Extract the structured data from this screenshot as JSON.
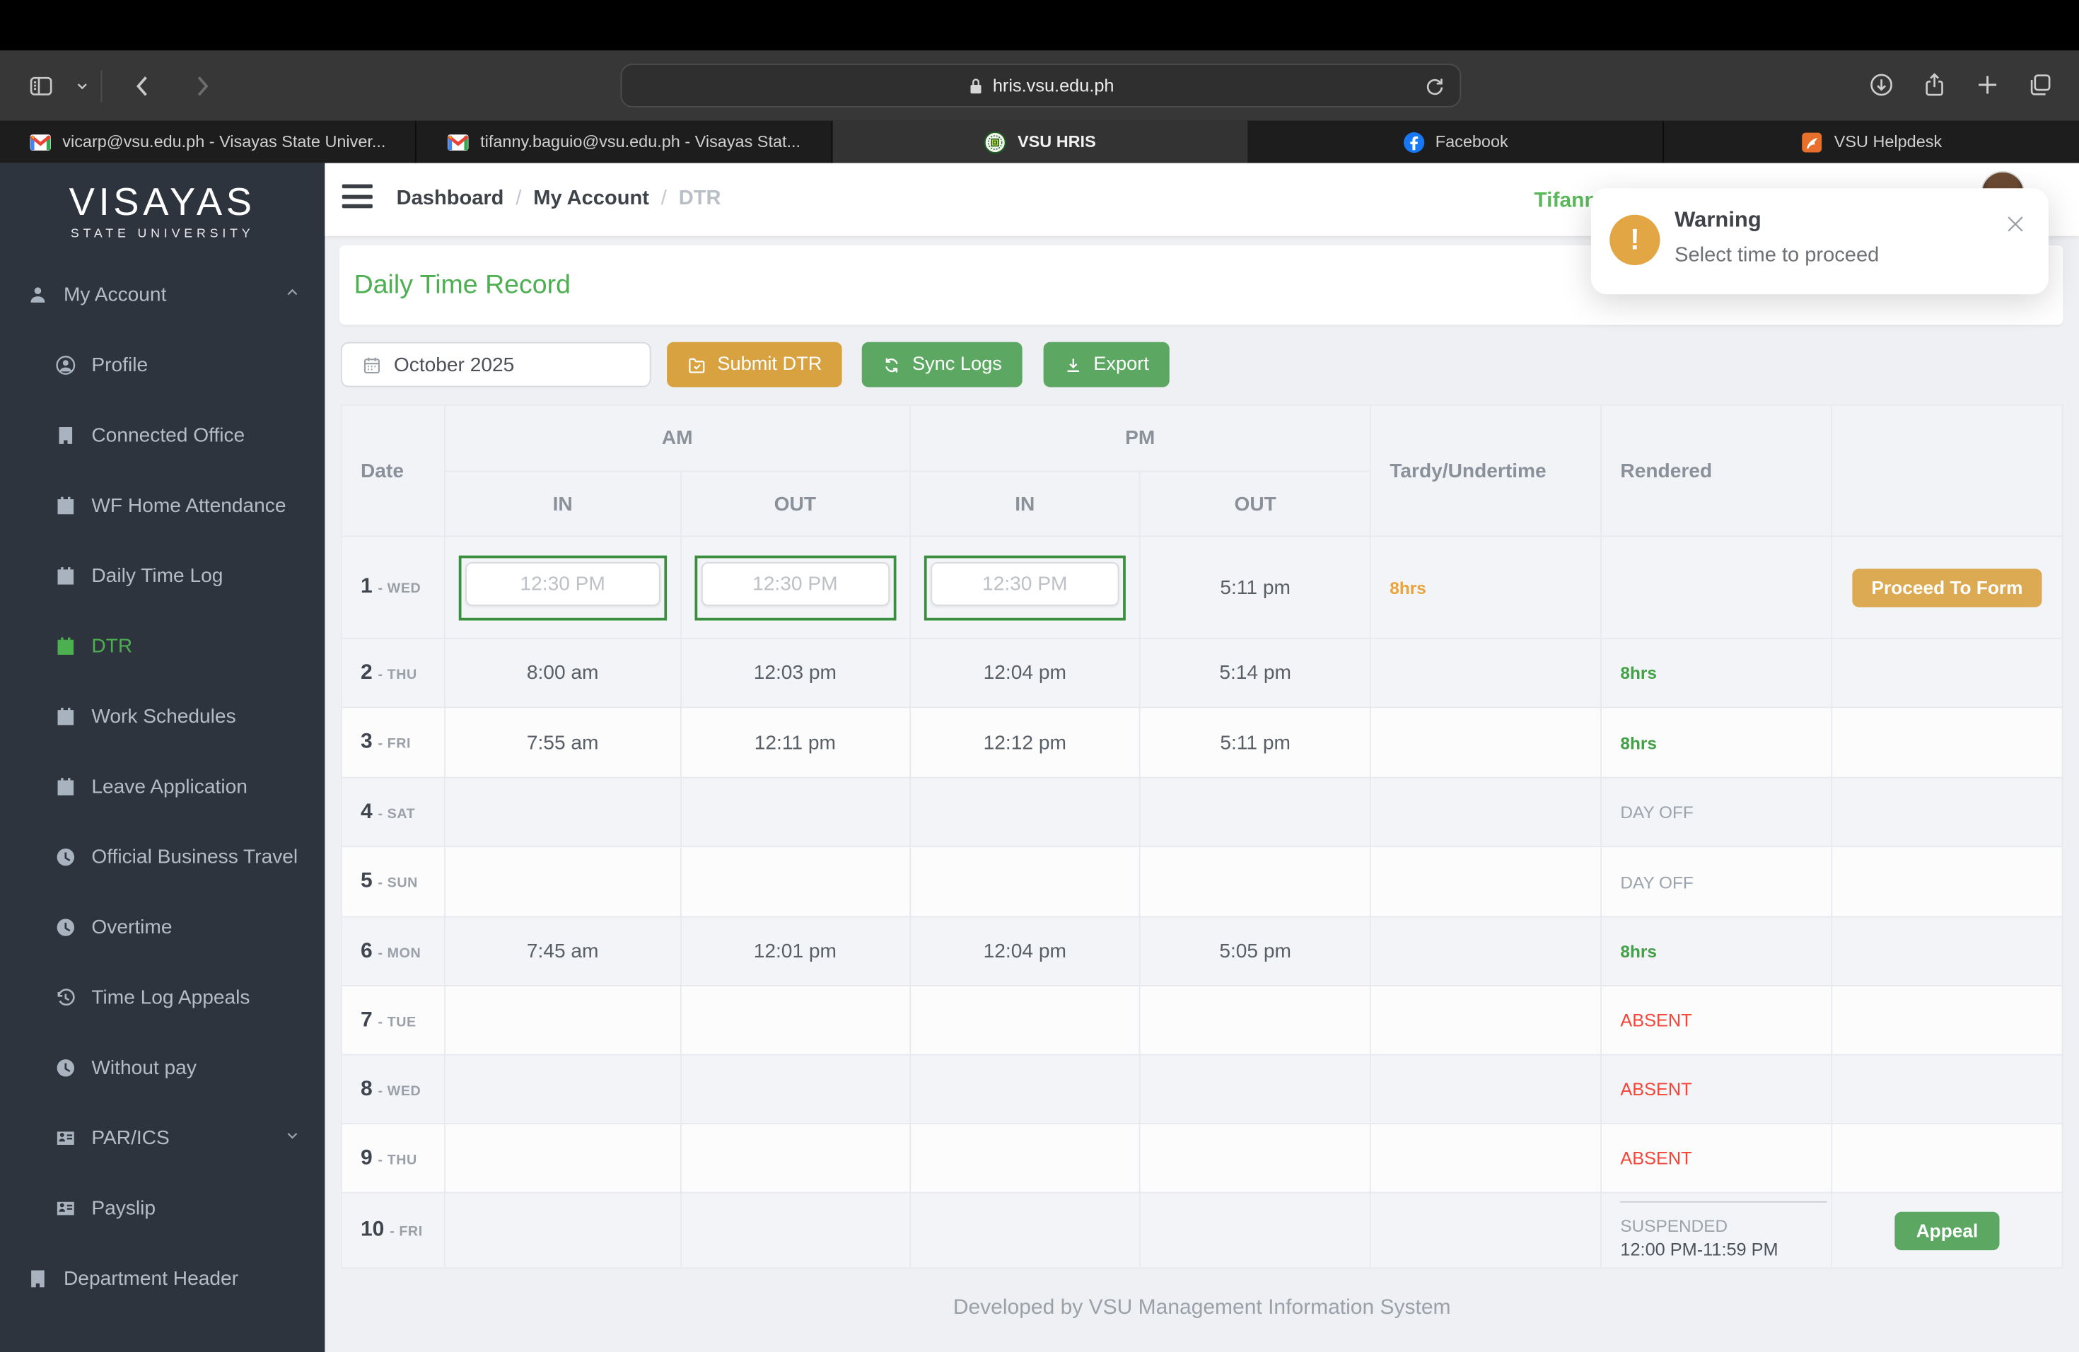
{
  "browser": {
    "url": "hris.vsu.edu.ph",
    "tabs": [
      {
        "title": "vicarp@vsu.edu.ph - Visayas State Univer...",
        "icon": "gmail-icon",
        "active": false
      },
      {
        "title": "tifanny.baguio@vsu.edu.ph - Visayas Stat...",
        "icon": "gmail-icon",
        "active": false
      },
      {
        "title": "VSU HRIS",
        "icon": "vsu-seal-icon",
        "active": true
      },
      {
        "title": "Facebook",
        "icon": "facebook-icon",
        "active": false
      },
      {
        "title": "VSU Helpdesk",
        "icon": "helpdesk-icon",
        "active": false
      }
    ]
  },
  "sidebar": {
    "logo_title": "VISAYAS",
    "logo_subtitle": "STATE UNIVERSITY",
    "items": [
      {
        "label": "My Account",
        "icon": "user",
        "level": "top",
        "chevron": "up",
        "active": false
      },
      {
        "label": "Profile",
        "icon": "user-circle",
        "level": "sub",
        "active": false
      },
      {
        "label": "Connected Office",
        "icon": "building",
        "level": "sub",
        "active": false
      },
      {
        "label": "WF Home Attendance",
        "icon": "calendar",
        "level": "sub",
        "active": false
      },
      {
        "label": "Daily Time Log",
        "icon": "calendar",
        "level": "sub",
        "active": false
      },
      {
        "label": "DTR",
        "icon": "calendar",
        "level": "sub",
        "active": true
      },
      {
        "label": "Work Schedules",
        "icon": "calendar",
        "level": "sub",
        "active": false
      },
      {
        "label": "Leave Application",
        "icon": "calendar",
        "level": "sub",
        "active": false
      },
      {
        "label": "Official Business Travel",
        "icon": "clock",
        "level": "sub",
        "active": false
      },
      {
        "label": "Overtime",
        "icon": "clock",
        "level": "sub",
        "active": false
      },
      {
        "label": "Time Log Appeals",
        "icon": "history",
        "level": "sub",
        "active": false
      },
      {
        "label": "Without pay",
        "icon": "clock",
        "level": "sub",
        "active": false
      },
      {
        "label": "PAR/ICS",
        "icon": "idcard",
        "level": "sub",
        "chevron": "down",
        "active": false
      },
      {
        "label": "Payslip",
        "icon": "idcard",
        "level": "sub",
        "active": false
      },
      {
        "label": "Department Header",
        "icon": "building",
        "level": "top",
        "active": false
      }
    ]
  },
  "header": {
    "breadcrumb": [
      "Dashboard",
      "My Account",
      "DTR"
    ],
    "user_name": "Tifann"
  },
  "toast": {
    "title": "Warning",
    "message": "Select time to proceed"
  },
  "page": {
    "title": "Daily Time Record",
    "month_value": "October 2025",
    "submit_label": "Submit DTR",
    "sync_label": "Sync Logs",
    "export_label": "Export"
  },
  "table": {
    "header": {
      "date": "Date",
      "am": "AM",
      "pm": "PM",
      "in": "IN",
      "out": "OUT",
      "tardy": "Tardy/Undertime",
      "rendered": "Rendered"
    },
    "rows": [
      {
        "date_num": "1",
        "date_day": "WED",
        "editable": true,
        "time_placeholder": "12:30 PM",
        "am_in": "",
        "am_out": "",
        "pm_in": "",
        "pm_out": "5:11 pm",
        "tardy": "8hrs",
        "rendered": null,
        "action": "Proceed To Form"
      },
      {
        "date_num": "2",
        "date_day": "THU",
        "am_in": "8:00 am",
        "am_out": "12:03 pm",
        "pm_in": "12:04 pm",
        "pm_out": "5:14 pm",
        "tardy": "",
        "rendered": {
          "type": "hours",
          "text": "8hrs"
        },
        "action": null
      },
      {
        "date_num": "3",
        "date_day": "FRI",
        "am_in": "7:55 am",
        "am_out": "12:11 pm",
        "pm_in": "12:12 pm",
        "pm_out": "5:11 pm",
        "tardy": "",
        "rendered": {
          "type": "hours",
          "text": "8hrs"
        },
        "action": null
      },
      {
        "date_num": "4",
        "date_day": "SAT",
        "am_in": "",
        "am_out": "",
        "pm_in": "",
        "pm_out": "",
        "tardy": "",
        "rendered": {
          "type": "dayoff",
          "text": "DAY OFF"
        },
        "action": null
      },
      {
        "date_num": "5",
        "date_day": "SUN",
        "am_in": "",
        "am_out": "",
        "pm_in": "",
        "pm_out": "",
        "tardy": "",
        "rendered": {
          "type": "dayoff",
          "text": "DAY OFF"
        },
        "action": null
      },
      {
        "date_num": "6",
        "date_day": "MON",
        "am_in": "7:45 am",
        "am_out": "12:01 pm",
        "pm_in": "12:04 pm",
        "pm_out": "5:05 pm",
        "tardy": "",
        "rendered": {
          "type": "hours",
          "text": "8hrs"
        },
        "action": null
      },
      {
        "date_num": "7",
        "date_day": "TUE",
        "am_in": "",
        "am_out": "",
        "pm_in": "",
        "pm_out": "",
        "tardy": "",
        "rendered": {
          "type": "absent",
          "text": "ABSENT"
        },
        "action": null
      },
      {
        "date_num": "8",
        "date_day": "WED",
        "am_in": "",
        "am_out": "",
        "pm_in": "",
        "pm_out": "",
        "tardy": "",
        "rendered": {
          "type": "absent",
          "text": "ABSENT"
        },
        "action": null
      },
      {
        "date_num": "9",
        "date_day": "THU",
        "am_in": "",
        "am_out": "",
        "pm_in": "",
        "pm_out": "",
        "tardy": "",
        "rendered": {
          "type": "absent",
          "text": "ABSENT"
        },
        "action": null
      },
      {
        "date_num": "10",
        "date_day": "FRI",
        "am_in": "",
        "am_out": "",
        "pm_in": "",
        "pm_out": "",
        "tardy": "",
        "rendered": {
          "type": "suspended",
          "text": "SUSPENDED",
          "detail": "12:00 PM-11:59 PM"
        },
        "action": "Appeal"
      }
    ]
  },
  "footer": {
    "text": "Developed by VSU Management Information System"
  },
  "colors": {
    "accent_green": "#4caf50",
    "button_green": "#5ca862",
    "button_tan": "#d7a23f",
    "warning_orange": "#e2a744",
    "absent_red": "#f44538",
    "sidebar_bg": "#2e343d"
  }
}
